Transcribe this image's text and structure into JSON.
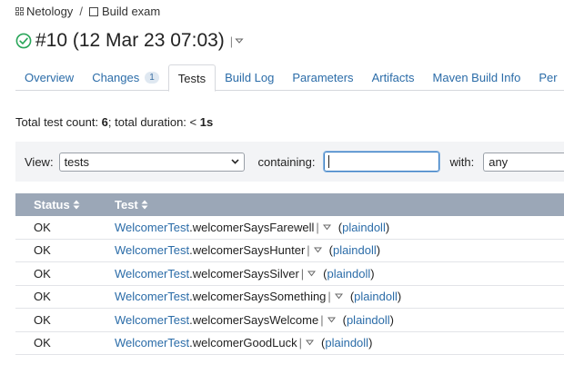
{
  "breadcrumb": {
    "project": "Netology",
    "separator": "/",
    "build_config": "Build exam"
  },
  "header": {
    "title": "#10 (12 Mar 23 07:03)",
    "separator": "|",
    "status_icon": "check-circle-icon",
    "status_color": "#2aa65a"
  },
  "tabs": [
    {
      "label": "Overview"
    },
    {
      "label": "Changes",
      "badge": "1"
    },
    {
      "label": "Tests",
      "active": true
    },
    {
      "label": "Build Log"
    },
    {
      "label": "Parameters"
    },
    {
      "label": "Artifacts"
    },
    {
      "label": "Maven Build Info"
    },
    {
      "label": "Per"
    }
  ],
  "summary": {
    "prefix": "Total test count: ",
    "count": "6",
    "middle": "; total duration: < ",
    "duration": "1s"
  },
  "filter": {
    "view_label": "View:",
    "view_value": "tests",
    "containing_label": "containing:",
    "containing_value": "",
    "with_label": "with:",
    "with_value": "any"
  },
  "table": {
    "headers": {
      "status": "Status",
      "test": "Test"
    },
    "rows": [
      {
        "status": "OK",
        "suite": "WelcomerTest",
        "method": ".welcomerSaysFarewell",
        "owner": "plaindoll"
      },
      {
        "status": "OK",
        "suite": "WelcomerTest",
        "method": ".welcomerSaysHunter",
        "owner": "plaindoll"
      },
      {
        "status": "OK",
        "suite": "WelcomerTest",
        "method": ".welcomerSaysSilver",
        "owner": "plaindoll"
      },
      {
        "status": "OK",
        "suite": "WelcomerTest",
        "method": ".welcomerSaysSomething",
        "owner": "plaindoll"
      },
      {
        "status": "OK",
        "suite": "WelcomerTest",
        "method": ".welcomerSaysWelcome",
        "owner": "plaindoll"
      },
      {
        "status": "OK",
        "suite": "WelcomerTest",
        "method": ".welcomerGoodLuck",
        "owner": "plaindoll"
      }
    ],
    "row_separator": "|",
    "owner_open": "(",
    "owner_close": ")"
  },
  "colors": {
    "link": "#2b6ca8",
    "header_bg": "#9ba7b7",
    "filter_bg": "#f3f4f6"
  }
}
